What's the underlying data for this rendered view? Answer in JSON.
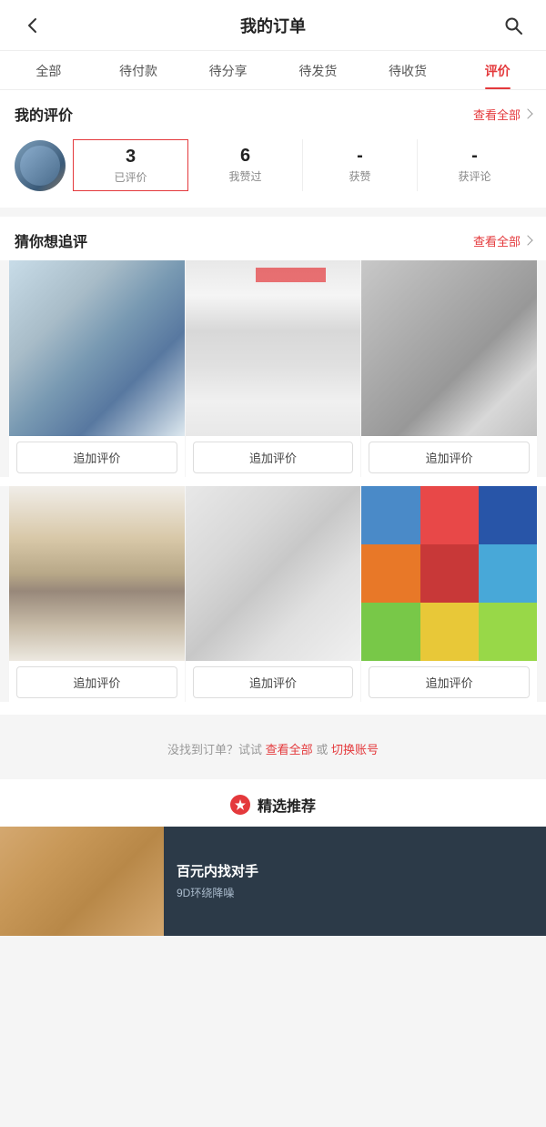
{
  "header": {
    "title": "我的订单",
    "back_label": "‹",
    "search_label": "⌕"
  },
  "tabs": [
    {
      "id": "all",
      "label": "全部",
      "active": false
    },
    {
      "id": "pending_pay",
      "label": "待付款",
      "active": false
    },
    {
      "id": "pending_share",
      "label": "待分享",
      "active": false
    },
    {
      "id": "pending_ship",
      "label": "待发货",
      "active": false
    },
    {
      "id": "pending_receive",
      "label": "待收货",
      "active": false
    },
    {
      "id": "review",
      "label": "评价",
      "active": true
    }
  ],
  "my_review": {
    "section_title": "我的评价",
    "see_all_label": "查看全部",
    "stats": [
      {
        "id": "reviewed",
        "num": "3",
        "label": "已评价",
        "active": true
      },
      {
        "id": "liked",
        "num": "6",
        "label": "我赞过",
        "active": false
      },
      {
        "id": "received_likes",
        "num": "-",
        "label": "获赞",
        "active": false
      },
      {
        "id": "received_comments",
        "num": "-",
        "label": "获评论",
        "active": false
      }
    ]
  },
  "guess_review": {
    "section_title": "猜你想追评",
    "see_all_label": "查看全部",
    "products": [
      {
        "id": "p1",
        "add_label": "追加评价"
      },
      {
        "id": "p2",
        "add_label": "追加评价"
      },
      {
        "id": "p3",
        "add_label": "追加评价"
      },
      {
        "id": "p4",
        "add_label": "追加评价"
      },
      {
        "id": "p5",
        "add_label": "追加评价"
      },
      {
        "id": "p6",
        "add_label": "追加评价"
      }
    ]
  },
  "footer_note": {
    "text_before": "没找到订单？试试",
    "link1": "查看全部",
    "text_middle": "或",
    "link2": "切换账号"
  },
  "featured": {
    "title": "精选推荐",
    "product_title": "百元内找对手",
    "product_sub": "9D环绕降噪"
  }
}
